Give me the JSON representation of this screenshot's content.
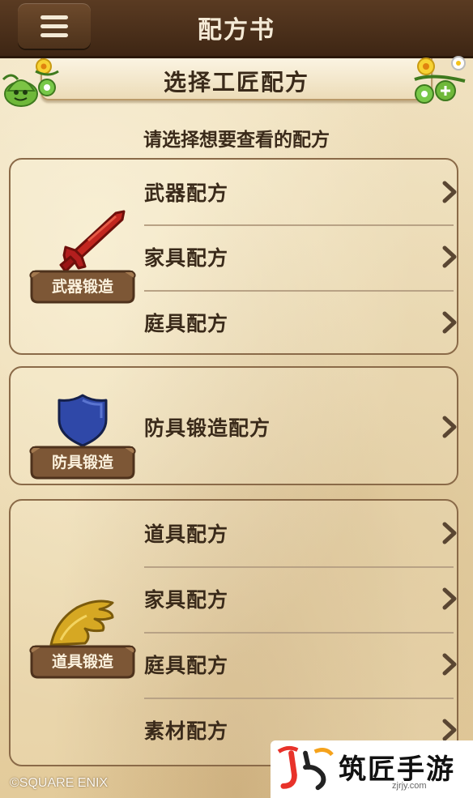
{
  "header": {
    "title": "配方书"
  },
  "section": {
    "title": "选择工匠配方",
    "instruction": "请选择想要查看的配方"
  },
  "groups": [
    {
      "emblem_icon": "sword-icon",
      "category_label": "武器锻造",
      "items": [
        {
          "label": "武器配方"
        },
        {
          "label": "家具配方"
        },
        {
          "label": "庭具配方"
        }
      ]
    },
    {
      "emblem_icon": "shield-icon",
      "category_label": "防具锻造",
      "items": [
        {
          "label": "防具锻造配方"
        }
      ]
    },
    {
      "emblem_icon": "wing-icon",
      "category_label": "道具锻造",
      "items": [
        {
          "label": "道具配方"
        },
        {
          "label": "家具配方"
        },
        {
          "label": "庭具配方"
        },
        {
          "label": "素材配方"
        }
      ]
    }
  ],
  "footer": {
    "copyright": "©SQUARE ENIX"
  },
  "watermark": {
    "name": "筑匠手游",
    "url": "zjrjy.com"
  },
  "colors": {
    "header_bg": "#4a2f1a",
    "parchment": "#ead9b4",
    "text": "#3a2a1a",
    "sword": "#b31e1e",
    "shield": "#2f48a8",
    "wing": "#d6a823",
    "scroll": "#7a5535"
  }
}
